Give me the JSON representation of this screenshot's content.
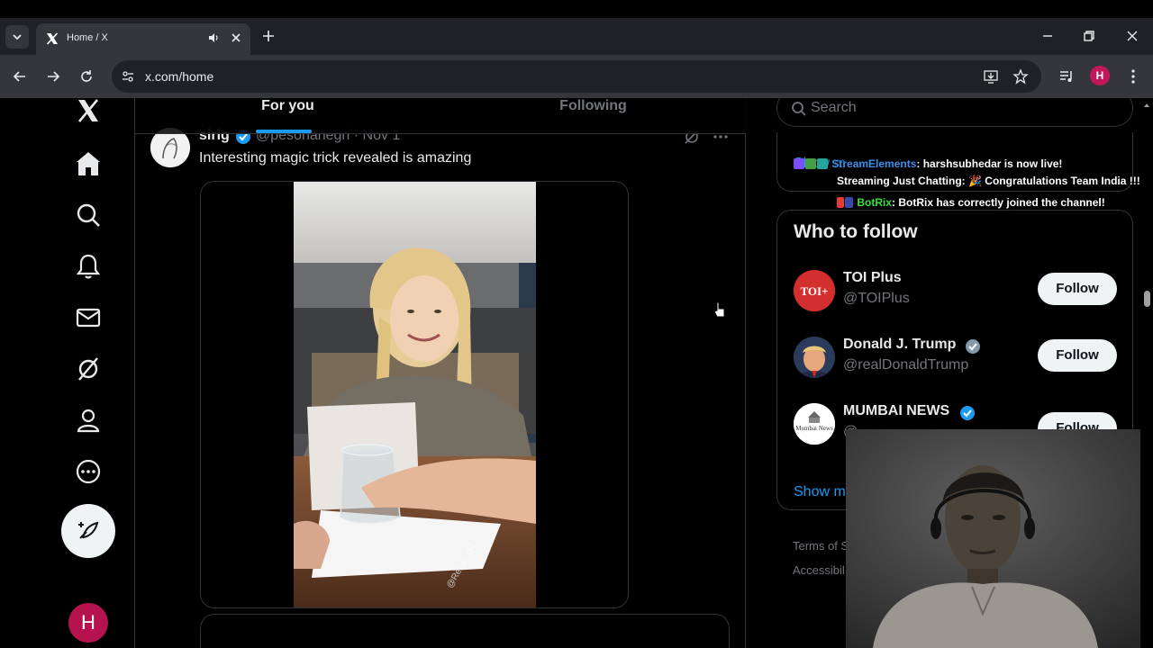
{
  "browser": {
    "tab_title": "Home / X",
    "url": "x.com/home",
    "profile_initial": "H"
  },
  "sidebar": {
    "items": [
      {
        "name": "x-logo-icon"
      },
      {
        "name": "home-icon"
      },
      {
        "name": "explore-icon"
      },
      {
        "name": "notifications-icon"
      },
      {
        "name": "messages-icon"
      },
      {
        "name": "grok-icon"
      },
      {
        "name": "profile-icon"
      },
      {
        "name": "more-icon"
      }
    ],
    "avatar_initial": "H"
  },
  "feed": {
    "tabs": [
      {
        "label": "For you",
        "active": true
      },
      {
        "label": "Following",
        "active": false
      }
    ],
    "post": {
      "name": "sirig",
      "handle": "@pesonanegri · Nov 1",
      "text": "Interesting magic trick revealed is amazing",
      "watermark": "@ReLa...gi1"
    }
  },
  "right": {
    "search_placeholder": "Search",
    "trend_show_more": "Show m",
    "who_to_follow": {
      "title": "Who to follow",
      "accounts": [
        {
          "name": "TOI Plus",
          "handle": "@TOIPlus",
          "verified": false,
          "avatar_text": "TOI+",
          "follow_label": "Follow"
        },
        {
          "name": "Donald J. Trump",
          "handle": "@realDonaldTrump",
          "verified": true,
          "avatar_text": "",
          "follow_label": "Follow"
        },
        {
          "name": "MUMBAI NEWS",
          "handle": "@",
          "verified": true,
          "avatar_text": "Mumbai News",
          "follow_label": "Follow"
        }
      ],
      "show_more": "Show m"
    },
    "footer": [
      "Terms of S",
      "Accessibil"
    ]
  },
  "chat_overlay": {
    "lines": [
      {
        "user": "StreamElements",
        "text": ": harshsubhedar is now live!"
      },
      {
        "user": "",
        "text": "Streaming Just Chatting: 🎉 Congratulations Team India !!!"
      },
      {
        "user": "BotRix",
        "text": ": BotRix has correctly joined the channel!"
      }
    ]
  },
  "colors": {
    "accent": "#1d9bf0",
    "background": "#000000",
    "text_primary": "#e7e9ea",
    "text_secondary": "#71767b",
    "border": "#2f3336"
  }
}
